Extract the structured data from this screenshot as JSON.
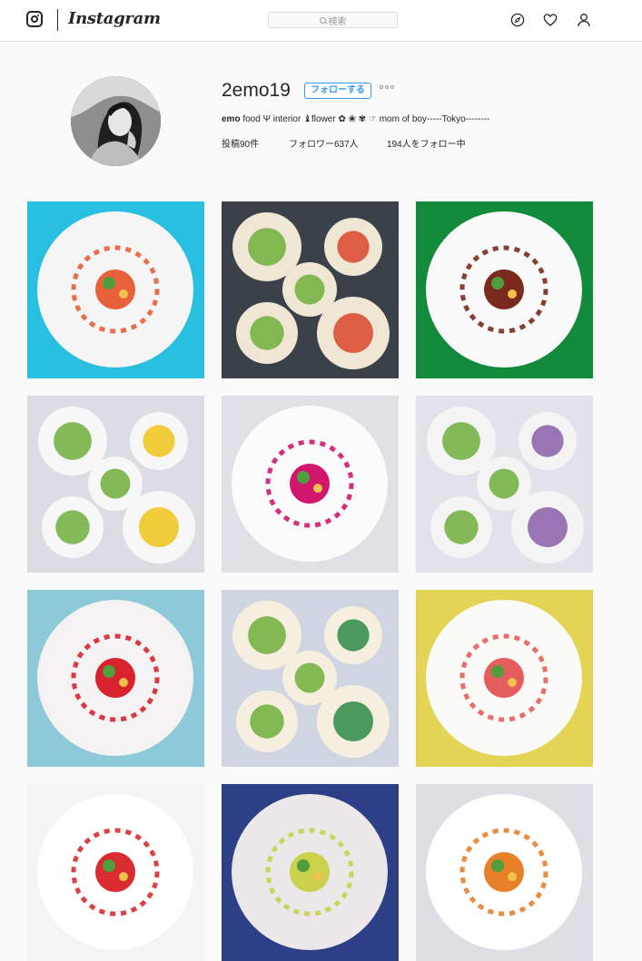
{
  "header": {
    "brand": "Instagram",
    "search_placeholder": "検索"
  },
  "profile": {
    "username": "2emo19",
    "follow_label": "フォローする",
    "bio_name": "emo",
    "bio_text": "food Ψ interior ♝flower ✿ ❀ ✾ ☞ mom of boy-----Tokyo--------",
    "posts_label": "投稿90件",
    "followers_label": "フォロワー637人",
    "following_label": "194人をフォロー中"
  },
  "posts": [
    {
      "background": "#29bfe0",
      "plate": "#f5f5f5",
      "accent": "#e8613a"
    },
    {
      "background": "#3a4149",
      "plate": "#efe6d4",
      "accent": "#d9452b"
    },
    {
      "background": "#118a3c",
      "plate": "#fafafa",
      "accent": "#7a2a1c"
    },
    {
      "background": "#dcdde4",
      "plate": "#f7f7f7",
      "accent": "#f0c419"
    },
    {
      "background": "#dfe1e6",
      "plate": "#fbfbfb",
      "accent": "#d1166e"
    },
    {
      "background": "#e2e3ea",
      "plate": "#f4f4f4",
      "accent": "#8a5ea8"
    },
    {
      "background": "#8ec9da",
      "plate": "#f4f2f2",
      "accent": "#d8222d"
    },
    {
      "background": "#cfd6e2",
      "plate": "#f6efe0",
      "accent": "#2e8a47"
    },
    {
      "background": "#e4d456",
      "plate": "#fafaf7",
      "accent": "#e65d5d"
    },
    {
      "background": "#f4f4f4",
      "plate": "#ffffff",
      "accent": "#d92b30"
    },
    {
      "background": "#2d3f86",
      "plate": "#ece8ea",
      "accent": "#c9d24a"
    },
    {
      "background": "#dedfe4",
      "plate": "#ffffff",
      "accent": "#e8802a"
    }
  ]
}
